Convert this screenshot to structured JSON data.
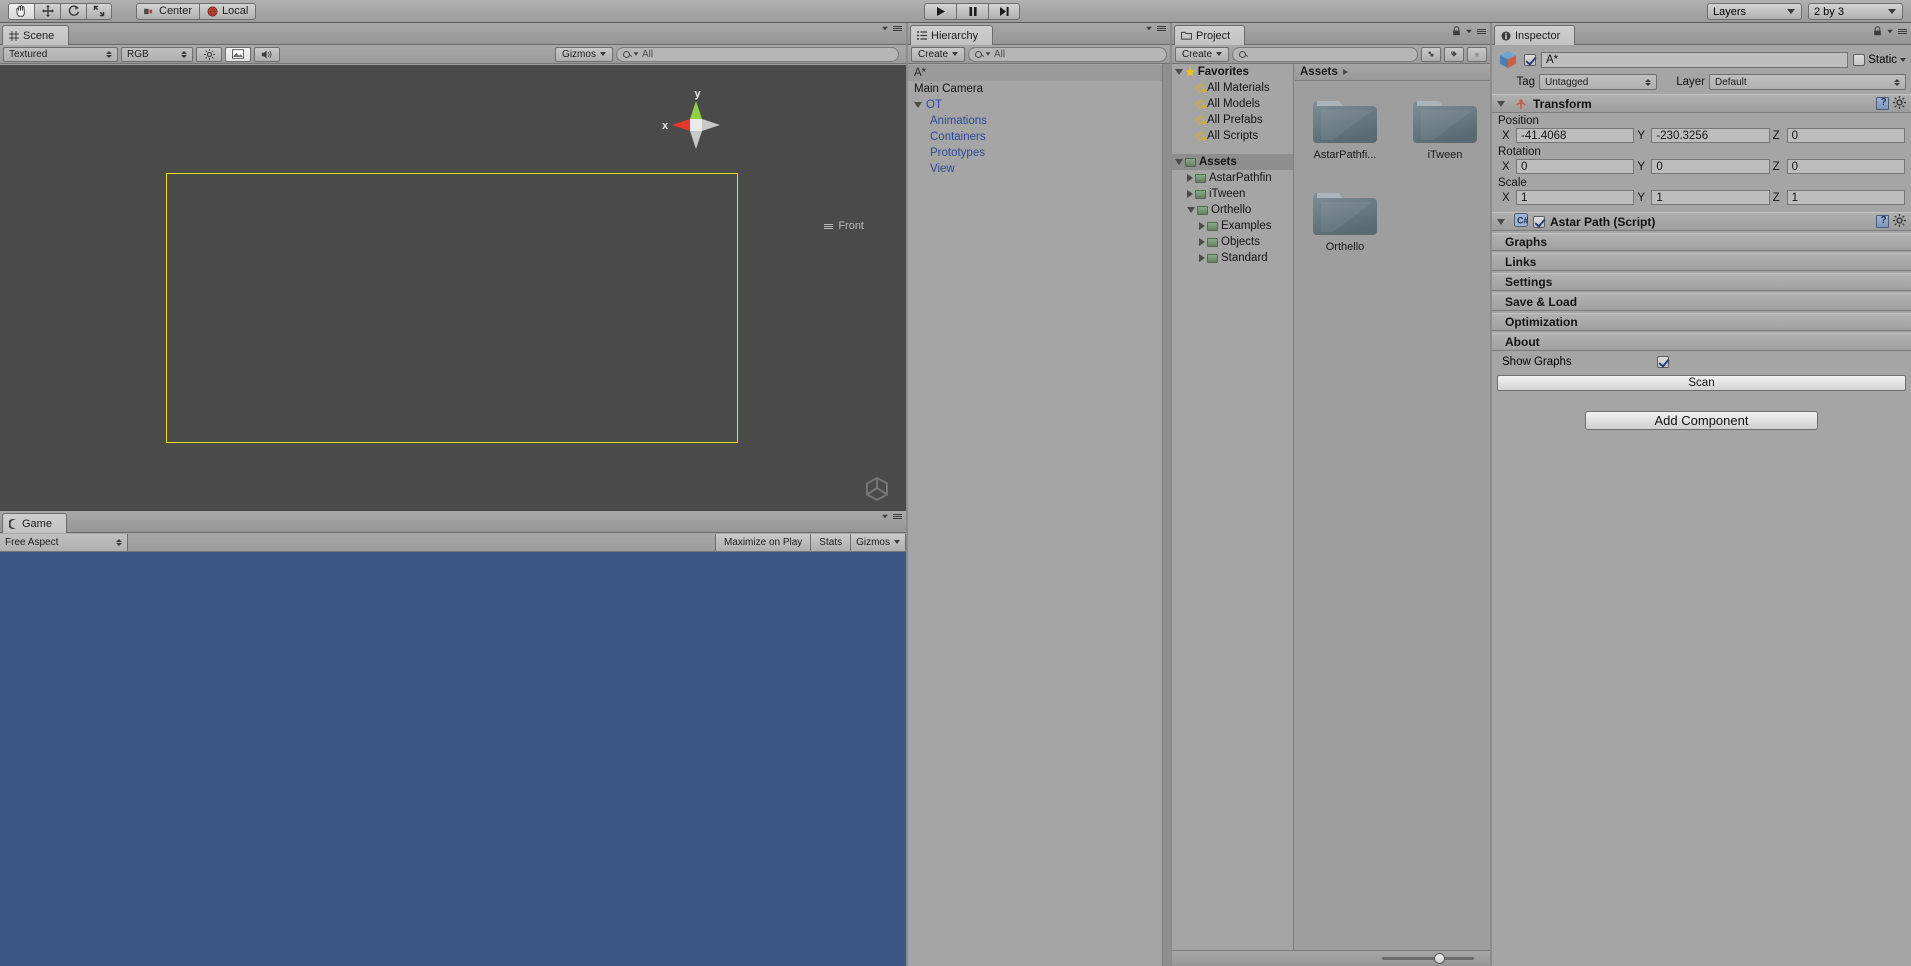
{
  "toolbar": {
    "tools": [
      {
        "name": "hand-tool",
        "icon": "hand",
        "active": true
      },
      {
        "name": "move-tool",
        "icon": "move",
        "active": false
      },
      {
        "name": "rotate-tool",
        "icon": "rotate",
        "active": false
      },
      {
        "name": "scale-tool",
        "icon": "scale",
        "active": false
      }
    ],
    "pivot_label": "Center",
    "space_label": "Local",
    "play_label": "▶",
    "pause_label": "❙❙",
    "step_label": "▶│",
    "layers_label": "Layers",
    "layout_label": "2 by 3"
  },
  "scene": {
    "tab_title": "Scene",
    "draw_mode": "Textured",
    "render_mode": "RGB",
    "gizmos_label": "Gizmos",
    "search_placeholder": "All",
    "axis_x": "x",
    "axis_y": "y",
    "view_orientation": "Front",
    "selection_rect_color": "#f2e11e",
    "background_color": "#4a4a4a"
  },
  "game": {
    "tab_title": "Game",
    "aspect_label": "Free Aspect",
    "maximize_label": "Maximize on Play",
    "stats_label": "Stats",
    "gizmos_label": "Gizmos",
    "view_color": "#3b5585"
  },
  "hierarchy": {
    "tab_title": "Hierarchy",
    "create_label": "Create",
    "search_placeholder": "All",
    "items": [
      {
        "label": "A*",
        "indent": 0,
        "selected": true,
        "prefab": false,
        "expand": "none"
      },
      {
        "label": "Main Camera",
        "indent": 0,
        "selected": false,
        "prefab": false,
        "expand": "none"
      },
      {
        "label": "OT",
        "indent": 0,
        "selected": false,
        "prefab": true,
        "expand": "down"
      },
      {
        "label": "Animations",
        "indent": 1,
        "selected": false,
        "prefab": true,
        "expand": "none"
      },
      {
        "label": "Containers",
        "indent": 1,
        "selected": false,
        "prefab": true,
        "expand": "none"
      },
      {
        "label": "Prototypes",
        "indent": 1,
        "selected": false,
        "prefab": true,
        "expand": "none"
      },
      {
        "label": "View",
        "indent": 1,
        "selected": false,
        "prefab": true,
        "expand": "none"
      }
    ]
  },
  "project": {
    "tab_title": "Project",
    "create_label": "Create",
    "search_placeholder": "",
    "breadcrumb": "Assets",
    "tree": [
      {
        "label": "Favorites",
        "indent": 0,
        "type": "star",
        "expand": "down",
        "bold": true,
        "selected": false
      },
      {
        "label": "All Materials",
        "indent": 1,
        "type": "search",
        "expand": "none",
        "bold": false,
        "selected": false
      },
      {
        "label": "All Models",
        "indent": 1,
        "type": "search",
        "expand": "none",
        "bold": false,
        "selected": false
      },
      {
        "label": "All Prefabs",
        "indent": 1,
        "type": "search",
        "expand": "none",
        "bold": false,
        "selected": false
      },
      {
        "label": "All Scripts",
        "indent": 1,
        "type": "search",
        "expand": "none",
        "bold": false,
        "selected": false
      },
      {
        "label": "",
        "indent": 0,
        "type": "spacer",
        "expand": "none",
        "bold": false,
        "selected": false
      },
      {
        "label": "Assets",
        "indent": 0,
        "type": "folder",
        "expand": "down",
        "bold": true,
        "selected": true
      },
      {
        "label": "AstarPathfin",
        "indent": 1,
        "type": "folder",
        "expand": "right",
        "bold": false,
        "selected": false
      },
      {
        "label": "iTween",
        "indent": 1,
        "type": "folder",
        "expand": "right",
        "bold": false,
        "selected": false
      },
      {
        "label": "Orthello",
        "indent": 1,
        "type": "folder",
        "expand": "down",
        "bold": false,
        "selected": false
      },
      {
        "label": "Examples",
        "indent": 2,
        "type": "folder",
        "expand": "right",
        "bold": false,
        "selected": false
      },
      {
        "label": "Objects",
        "indent": 2,
        "type": "folder",
        "expand": "right",
        "bold": false,
        "selected": false
      },
      {
        "label": "Standard",
        "indent": 2,
        "type": "folder",
        "expand": "right",
        "bold": false,
        "selected": false
      }
    ],
    "grid": [
      {
        "label": "AstarPathfi...",
        "icon": "folder"
      },
      {
        "label": "iTween",
        "icon": "folder"
      },
      {
        "label": "Orthello",
        "icon": "folder"
      }
    ]
  },
  "inspector": {
    "tab_title": "Inspector",
    "object_name": "A*",
    "object_enabled": true,
    "static_label": "Static",
    "static_checked": false,
    "tag_label": "Tag",
    "tag_value": "Untagged",
    "layer_label": "Layer",
    "layer_value": "Default",
    "transform": {
      "title": "Transform",
      "position_label": "Position",
      "rotation_label": "Rotation",
      "scale_label": "Scale",
      "axes": [
        "X",
        "Y",
        "Z"
      ],
      "position": [
        "-41.4068",
        "-230.3256",
        "0"
      ],
      "rotation": [
        "0",
        "0",
        "0"
      ],
      "scale": [
        "1",
        "1",
        "1"
      ]
    },
    "script": {
      "title": "Astar Path (Script)",
      "enabled": true,
      "sections": [
        "Graphs",
        "Links",
        "Settings",
        "Save & Load",
        "Optimization",
        "About"
      ],
      "show_graphs_label": "Show Graphs",
      "show_graphs_checked": true,
      "scan_label": "Scan"
    },
    "add_component_label": "Add Component"
  }
}
